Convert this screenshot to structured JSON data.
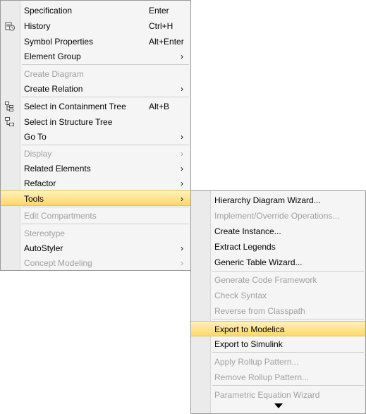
{
  "main_menu": {
    "items": [
      {
        "label": "Specification",
        "shortcut": "Enter"
      },
      {
        "label": "History",
        "shortcut": "Ctrl+H"
      },
      {
        "label": "Symbol Properties",
        "shortcut": "Alt+Enter"
      },
      {
        "label": "Element Group",
        "arrow": "›"
      },
      {
        "label": "Create Diagram"
      },
      {
        "label": "Create Relation",
        "arrow": "›"
      },
      {
        "label": "Select in Containment Tree",
        "shortcut": "Alt+B"
      },
      {
        "label": "Select in Structure Tree"
      },
      {
        "label": "Go To",
        "arrow": "›"
      },
      {
        "label": "Display",
        "arrow": "›"
      },
      {
        "label": "Related Elements",
        "arrow": "›"
      },
      {
        "label": "Refactor",
        "arrow": "›"
      },
      {
        "label": "Tools",
        "arrow": "›"
      },
      {
        "label": "Edit Compartments"
      },
      {
        "label": "Stereotype"
      },
      {
        "label": "AutoStyler",
        "arrow": "›"
      },
      {
        "label": "Concept Modeling",
        "arrow": "›"
      }
    ]
  },
  "tools_submenu": {
    "items": [
      {
        "label": "Hierarchy Diagram Wizard..."
      },
      {
        "label": "Implement/Override Operations..."
      },
      {
        "label": "Create Instance..."
      },
      {
        "label": "Extract Legends"
      },
      {
        "label": "Generic Table Wizard..."
      },
      {
        "label": "Generate Code Framework"
      },
      {
        "label": "Check Syntax"
      },
      {
        "label": "Reverse from Classpath"
      },
      {
        "label": "Export to Modelica"
      },
      {
        "label": "Export to Simulink"
      },
      {
        "label": "Apply Rollup Pattern..."
      },
      {
        "label": "Remove Rollup Pattern..."
      },
      {
        "label": "Parametric Equation Wizard"
      }
    ]
  },
  "colors": {
    "highlight": "#ffd86a",
    "disabled_text": "#a0a0a0"
  },
  "icons": [
    "history-icon",
    "containment-tree-icon",
    "structure-tree-icon",
    "scroll-down-arrow-icon"
  ]
}
